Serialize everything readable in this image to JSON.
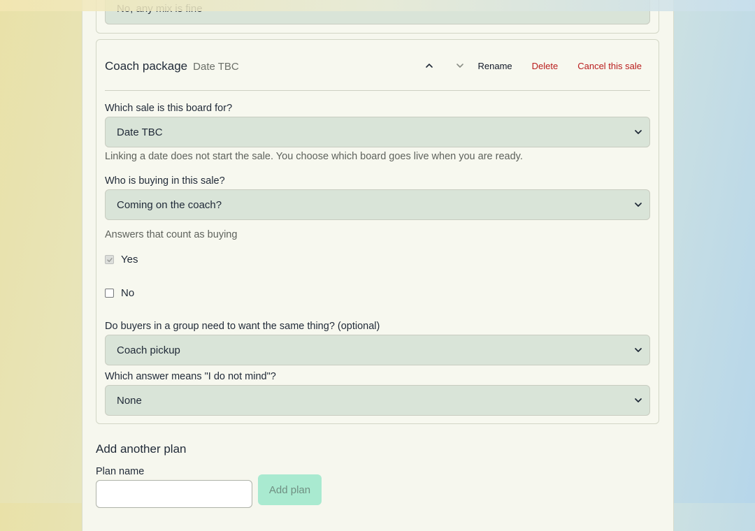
{
  "prev_card": {
    "select_value": "No, any mix is fine"
  },
  "plan": {
    "title": "Coach package",
    "subtitle": "Date TBC",
    "actions": {
      "rename": "Rename",
      "delete": "Delete",
      "cancel": "Cancel this sale"
    },
    "sale_label": "Which sale is this board for?",
    "sale_value": "Date TBC",
    "sale_help": "Linking a date does not start the sale. You choose which board goes live when you are ready.",
    "buying_label": "Who is buying in this sale?",
    "buying_value": "Coming on the coach?",
    "answers_label": "Answers that count as buying",
    "answers": [
      {
        "label": "Yes",
        "checked": true
      },
      {
        "label": "No",
        "checked": false
      }
    ],
    "same_label": "Do buyers in a group need to want the same thing? (optional)",
    "same_value": "Coach pickup",
    "mind_label": "Which answer means \"I do not mind\"?",
    "mind_value": "None"
  },
  "add_plan": {
    "title": "Add another plan",
    "name_label": "Plan name",
    "name_value": "",
    "button": "Add plan"
  },
  "colors": {
    "danger": "#b91c1c",
    "select_bg": "#d9e4d8",
    "button_bg": "#a9ead0"
  },
  "icons": {
    "move_up": "chevron-up-icon",
    "move_down": "chevron-down-icon",
    "select_caret": "chevron-down-icon",
    "checkmark": "checkmark-icon"
  }
}
